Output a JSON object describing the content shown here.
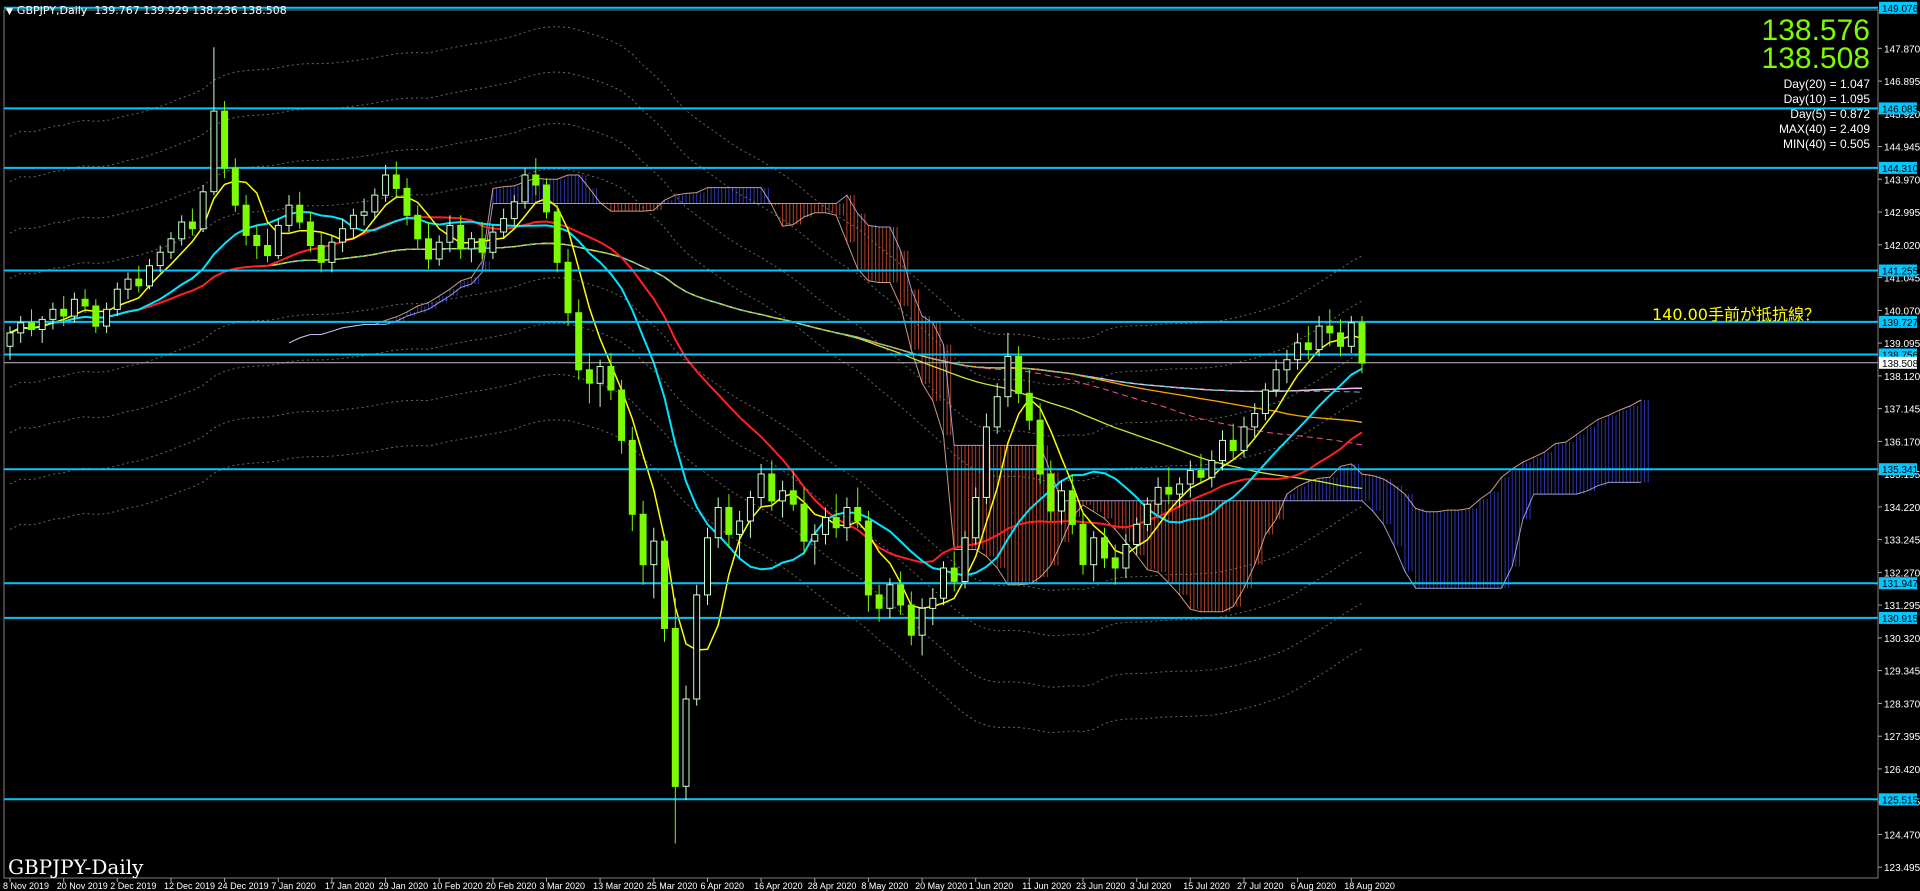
{
  "header": {
    "symbol": "GBPJPY,Daily",
    "ohlc": "139.767 139.929 138.236 138.508"
  },
  "corner_label": "GBPJPY-Daily",
  "prices": {
    "bid": "138.576",
    "ask": "138.508"
  },
  "stats": [
    "Day(20) = 1.047",
    "Day(10) = 1.095",
    "Day(5) = 0.872",
    "MAX(40) = 2.409",
    "MIN(40) = 0.505"
  ],
  "annotation": "140.00手前が抵抗線？",
  "colors": {
    "background": "#000000",
    "bull_candle": "#ccffcc",
    "bear_candle": "#7cfc00",
    "level_line": "#00c8ff",
    "ma_fast": "#ffff00",
    "ma_mid": "#00e5ff",
    "ma_slow": "#ff2020",
    "ma_long": "#ffa500",
    "ma_longest": "#ffe4b5",
    "ma_pink": "#ffb6ff",
    "ma_olive": "#c8e632",
    "cloud_red": "#ff6040",
    "cloud_blue": "#4050ff"
  },
  "chart_data": {
    "type": "candlestick",
    "title": "GBPJPY-Daily",
    "ylim": [
      123.5,
      149.1
    ],
    "price_ticks": [
      "147.870",
      "146.895",
      "145.920",
      "144.945",
      "143.970",
      "142.995",
      "142.020",
      "141.045",
      "140.070",
      "139.095",
      "138.120",
      "137.145",
      "136.170",
      "135.195",
      "134.220",
      "133.245",
      "132.270",
      "131.295",
      "130.320",
      "129.345",
      "128.370",
      "127.395",
      "126.420",
      "125.445",
      "124.470",
      "123.495"
    ],
    "level_labels": [
      {
        "price": 149.076,
        "label": "149.076"
      },
      {
        "price": 146.083,
        "label": "146.083"
      },
      {
        "price": 144.31,
        "label": "144.310"
      },
      {
        "price": 141.255,
        "label": "141.255"
      },
      {
        "price": 139.727,
        "label": "139.727"
      },
      {
        "price": 138.756,
        "label": "138.756"
      },
      {
        "price": 135.341,
        "label": "135.341"
      },
      {
        "price": 131.947,
        "label": "131.947"
      },
      {
        "price": 130.915,
        "label": "130.915"
      },
      {
        "price": 125.515,
        "label": "125.515"
      }
    ],
    "current_price_label": "138.508",
    "current_price": 138.508,
    "date_ticks": [
      "8 Nov 2019",
      "20 Nov 2019",
      "2 Dec 2019",
      "12 Dec 2019",
      "24 Dec 2019",
      "7 Jan 2020",
      "17 Jan 2020",
      "29 Jan 2020",
      "10 Feb 2020",
      "20 Feb 2020",
      "3 Mar 2020",
      "13 Mar 2020",
      "25 Mar 2020",
      "6 Apr 2020",
      "16 Apr 2020",
      "28 Apr 2020",
      "8 May 2020",
      "20 May 2020",
      "1 Jun 2020",
      "11 Jun 2020",
      "23 Jun 2020",
      "3 Jul 2020",
      "15 Jul 2020",
      "27 Jul 2020",
      "6 Aug 2020",
      "18 Aug 2020"
    ],
    "candles": [
      [
        139.0,
        139.6,
        138.6,
        139.4
      ],
      [
        139.4,
        139.9,
        139.1,
        139.7
      ],
      [
        139.7,
        140.1,
        139.3,
        139.5
      ],
      [
        139.5,
        139.9,
        139.1,
        139.8
      ],
      [
        139.8,
        140.3,
        139.5,
        140.1
      ],
      [
        140.1,
        140.5,
        139.6,
        139.9
      ],
      [
        139.9,
        140.6,
        139.7,
        140.4
      ],
      [
        140.4,
        140.7,
        140.0,
        140.2
      ],
      [
        140.2,
        140.4,
        139.4,
        139.6
      ],
      [
        139.6,
        140.3,
        139.4,
        140.1
      ],
      [
        140.1,
        140.9,
        139.9,
        140.7
      ],
      [
        140.7,
        141.2,
        140.4,
        141.0
      ],
      [
        141.0,
        141.4,
        140.6,
        140.8
      ],
      [
        140.8,
        141.6,
        140.7,
        141.4
      ],
      [
        141.4,
        142.0,
        141.2,
        141.8
      ],
      [
        141.8,
        142.4,
        141.6,
        142.2
      ],
      [
        142.2,
        142.9,
        142.0,
        142.7
      ],
      [
        142.7,
        143.1,
        142.3,
        142.5
      ],
      [
        142.5,
        143.8,
        142.4,
        143.6
      ],
      [
        143.6,
        147.9,
        143.5,
        146.0
      ],
      [
        146.0,
        146.3,
        144.0,
        144.3
      ],
      [
        144.3,
        144.6,
        143.0,
        143.2
      ],
      [
        143.2,
        143.5,
        142.0,
        142.3
      ],
      [
        142.3,
        142.6,
        141.6,
        142.0
      ],
      [
        142.0,
        142.5,
        141.5,
        141.7
      ],
      [
        141.7,
        142.8,
        141.6,
        142.6
      ],
      [
        142.6,
        143.5,
        142.4,
        143.2
      ],
      [
        143.2,
        143.6,
        142.5,
        142.7
      ],
      [
        142.7,
        143.0,
        141.8,
        142.0
      ],
      [
        142.0,
        142.4,
        141.2,
        141.5
      ],
      [
        141.5,
        142.3,
        141.2,
        142.1
      ],
      [
        142.1,
        142.8,
        141.8,
        142.5
      ],
      [
        142.5,
        143.1,
        142.2,
        142.9
      ],
      [
        142.9,
        143.4,
        142.6,
        143.0
      ],
      [
        143.0,
        143.7,
        142.8,
        143.5
      ],
      [
        143.5,
        144.4,
        143.3,
        144.1
      ],
      [
        144.1,
        144.5,
        143.4,
        143.7
      ],
      [
        143.7,
        144.0,
        142.6,
        142.9
      ],
      [
        142.9,
        143.2,
        141.9,
        142.2
      ],
      [
        142.2,
        142.7,
        141.3,
        141.6
      ],
      [
        141.6,
        142.3,
        141.4,
        142.1
      ],
      [
        142.1,
        142.9,
        141.8,
        142.6
      ],
      [
        142.6,
        142.9,
        141.6,
        141.9
      ],
      [
        141.9,
        142.4,
        141.5,
        142.2
      ],
      [
        142.2,
        142.7,
        141.6,
        141.8
      ],
      [
        141.8,
        142.6,
        141.6,
        142.4
      ],
      [
        142.4,
        143.1,
        142.2,
        142.8
      ],
      [
        142.8,
        143.5,
        142.6,
        143.3
      ],
      [
        143.3,
        144.3,
        143.1,
        144.1
      ],
      [
        144.1,
        144.6,
        143.5,
        143.8
      ],
      [
        143.8,
        144.0,
        142.8,
        143.0
      ],
      [
        143.0,
        143.2,
        141.2,
        141.5
      ],
      [
        141.5,
        141.9,
        139.6,
        140.0
      ],
      [
        140.0,
        140.4,
        138.0,
        138.3
      ],
      [
        138.3,
        138.8,
        137.3,
        137.9
      ],
      [
        137.9,
        138.6,
        137.2,
        138.4
      ],
      [
        138.4,
        138.8,
        137.4,
        137.7
      ],
      [
        137.7,
        138.0,
        135.8,
        136.2
      ],
      [
        136.2,
        136.6,
        133.5,
        134.0
      ],
      [
        134.0,
        134.4,
        131.9,
        132.5
      ],
      [
        132.5,
        133.6,
        131.5,
        133.2
      ],
      [
        133.2,
        133.4,
        130.2,
        130.6
      ],
      [
        130.6,
        131.5,
        124.2,
        125.9
      ],
      [
        125.9,
        128.9,
        125.5,
        128.5
      ],
      [
        128.5,
        131.9,
        128.3,
        131.6
      ],
      [
        131.6,
        133.6,
        131.3,
        133.3
      ],
      [
        133.3,
        134.5,
        133.0,
        134.2
      ],
      [
        134.2,
        134.6,
        133.0,
        133.4
      ],
      [
        133.4,
        134.1,
        132.7,
        133.8
      ],
      [
        133.8,
        134.7,
        133.3,
        134.5
      ],
      [
        134.5,
        135.5,
        134.2,
        135.2
      ],
      [
        135.2,
        135.6,
        134.1,
        134.4
      ],
      [
        134.4,
        135.0,
        133.9,
        134.7
      ],
      [
        134.7,
        135.3,
        134.1,
        134.3
      ],
      [
        134.3,
        134.8,
        132.8,
        133.2
      ],
      [
        133.2,
        133.7,
        132.5,
        133.4
      ],
      [
        133.4,
        134.2,
        133.1,
        133.9
      ],
      [
        133.9,
        134.6,
        133.3,
        133.6
      ],
      [
        133.6,
        134.5,
        133.2,
        134.2
      ],
      [
        134.2,
        134.8,
        133.6,
        133.8
      ],
      [
        133.8,
        134.1,
        131.1,
        131.6
      ],
      [
        131.6,
        131.9,
        130.8,
        131.2
      ],
      [
        131.2,
        132.1,
        130.9,
        131.9
      ],
      [
        131.9,
        132.3,
        131.0,
        131.3
      ],
      [
        131.3,
        131.7,
        130.1,
        130.4
      ],
      [
        130.4,
        131.5,
        129.8,
        131.2
      ],
      [
        131.2,
        131.8,
        130.7,
        131.5
      ],
      [
        131.5,
        132.6,
        131.3,
        132.4
      ],
      [
        132.4,
        132.9,
        131.7,
        132.0
      ],
      [
        132.0,
        133.5,
        131.8,
        133.3
      ],
      [
        133.3,
        134.8,
        133.1,
        134.5
      ],
      [
        134.5,
        137.0,
        134.3,
        136.6
      ],
      [
        136.6,
        137.9,
        136.4,
        137.5
      ],
      [
        137.5,
        139.4,
        137.2,
        138.7
      ],
      [
        138.7,
        139.0,
        137.3,
        137.6
      ],
      [
        137.6,
        138.3,
        136.5,
        136.8
      ],
      [
        136.8,
        137.3,
        134.9,
        135.2
      ],
      [
        135.2,
        135.6,
        133.8,
        134.1
      ],
      [
        134.1,
        135.0,
        133.7,
        134.7
      ],
      [
        134.7,
        135.2,
        133.4,
        133.7
      ],
      [
        133.7,
        134.1,
        132.2,
        132.5
      ],
      [
        132.5,
        133.5,
        132.0,
        133.3
      ],
      [
        133.3,
        133.6,
        132.4,
        132.7
      ],
      [
        132.7,
        133.1,
        131.9,
        132.4
      ],
      [
        132.4,
        133.4,
        132.1,
        133.1
      ],
      [
        133.1,
        133.9,
        132.8,
        133.7
      ],
      [
        133.7,
        134.5,
        133.5,
        134.3
      ],
      [
        134.3,
        135.1,
        134.0,
        134.8
      ],
      [
        134.8,
        135.4,
        134.3,
        134.6
      ],
      [
        134.6,
        135.1,
        134.2,
        134.9
      ],
      [
        134.9,
        135.6,
        134.5,
        135.3
      ],
      [
        135.3,
        135.8,
        134.9,
        135.1
      ],
      [
        135.1,
        135.9,
        134.8,
        135.6
      ],
      [
        135.6,
        136.5,
        135.3,
        136.2
      ],
      [
        136.2,
        136.7,
        135.6,
        135.9
      ],
      [
        135.9,
        136.9,
        135.7,
        136.6
      ],
      [
        136.6,
        137.3,
        136.3,
        137.0
      ],
      [
        137.0,
        137.9,
        136.8,
        137.7
      ],
      [
        137.7,
        138.6,
        137.5,
        138.3
      ],
      [
        138.3,
        138.9,
        137.9,
        138.6
      ],
      [
        138.6,
        139.4,
        138.3,
        139.1
      ],
      [
        139.1,
        139.6,
        138.6,
        138.9
      ],
      [
        138.9,
        139.9,
        138.7,
        139.6
      ],
      [
        139.6,
        140.1,
        139.0,
        139.4
      ],
      [
        139.4,
        139.8,
        138.7,
        139.0
      ],
      [
        139.0,
        139.9,
        138.8,
        139.7
      ],
      [
        139.7,
        139.9,
        138.2,
        138.5
      ]
    ]
  }
}
